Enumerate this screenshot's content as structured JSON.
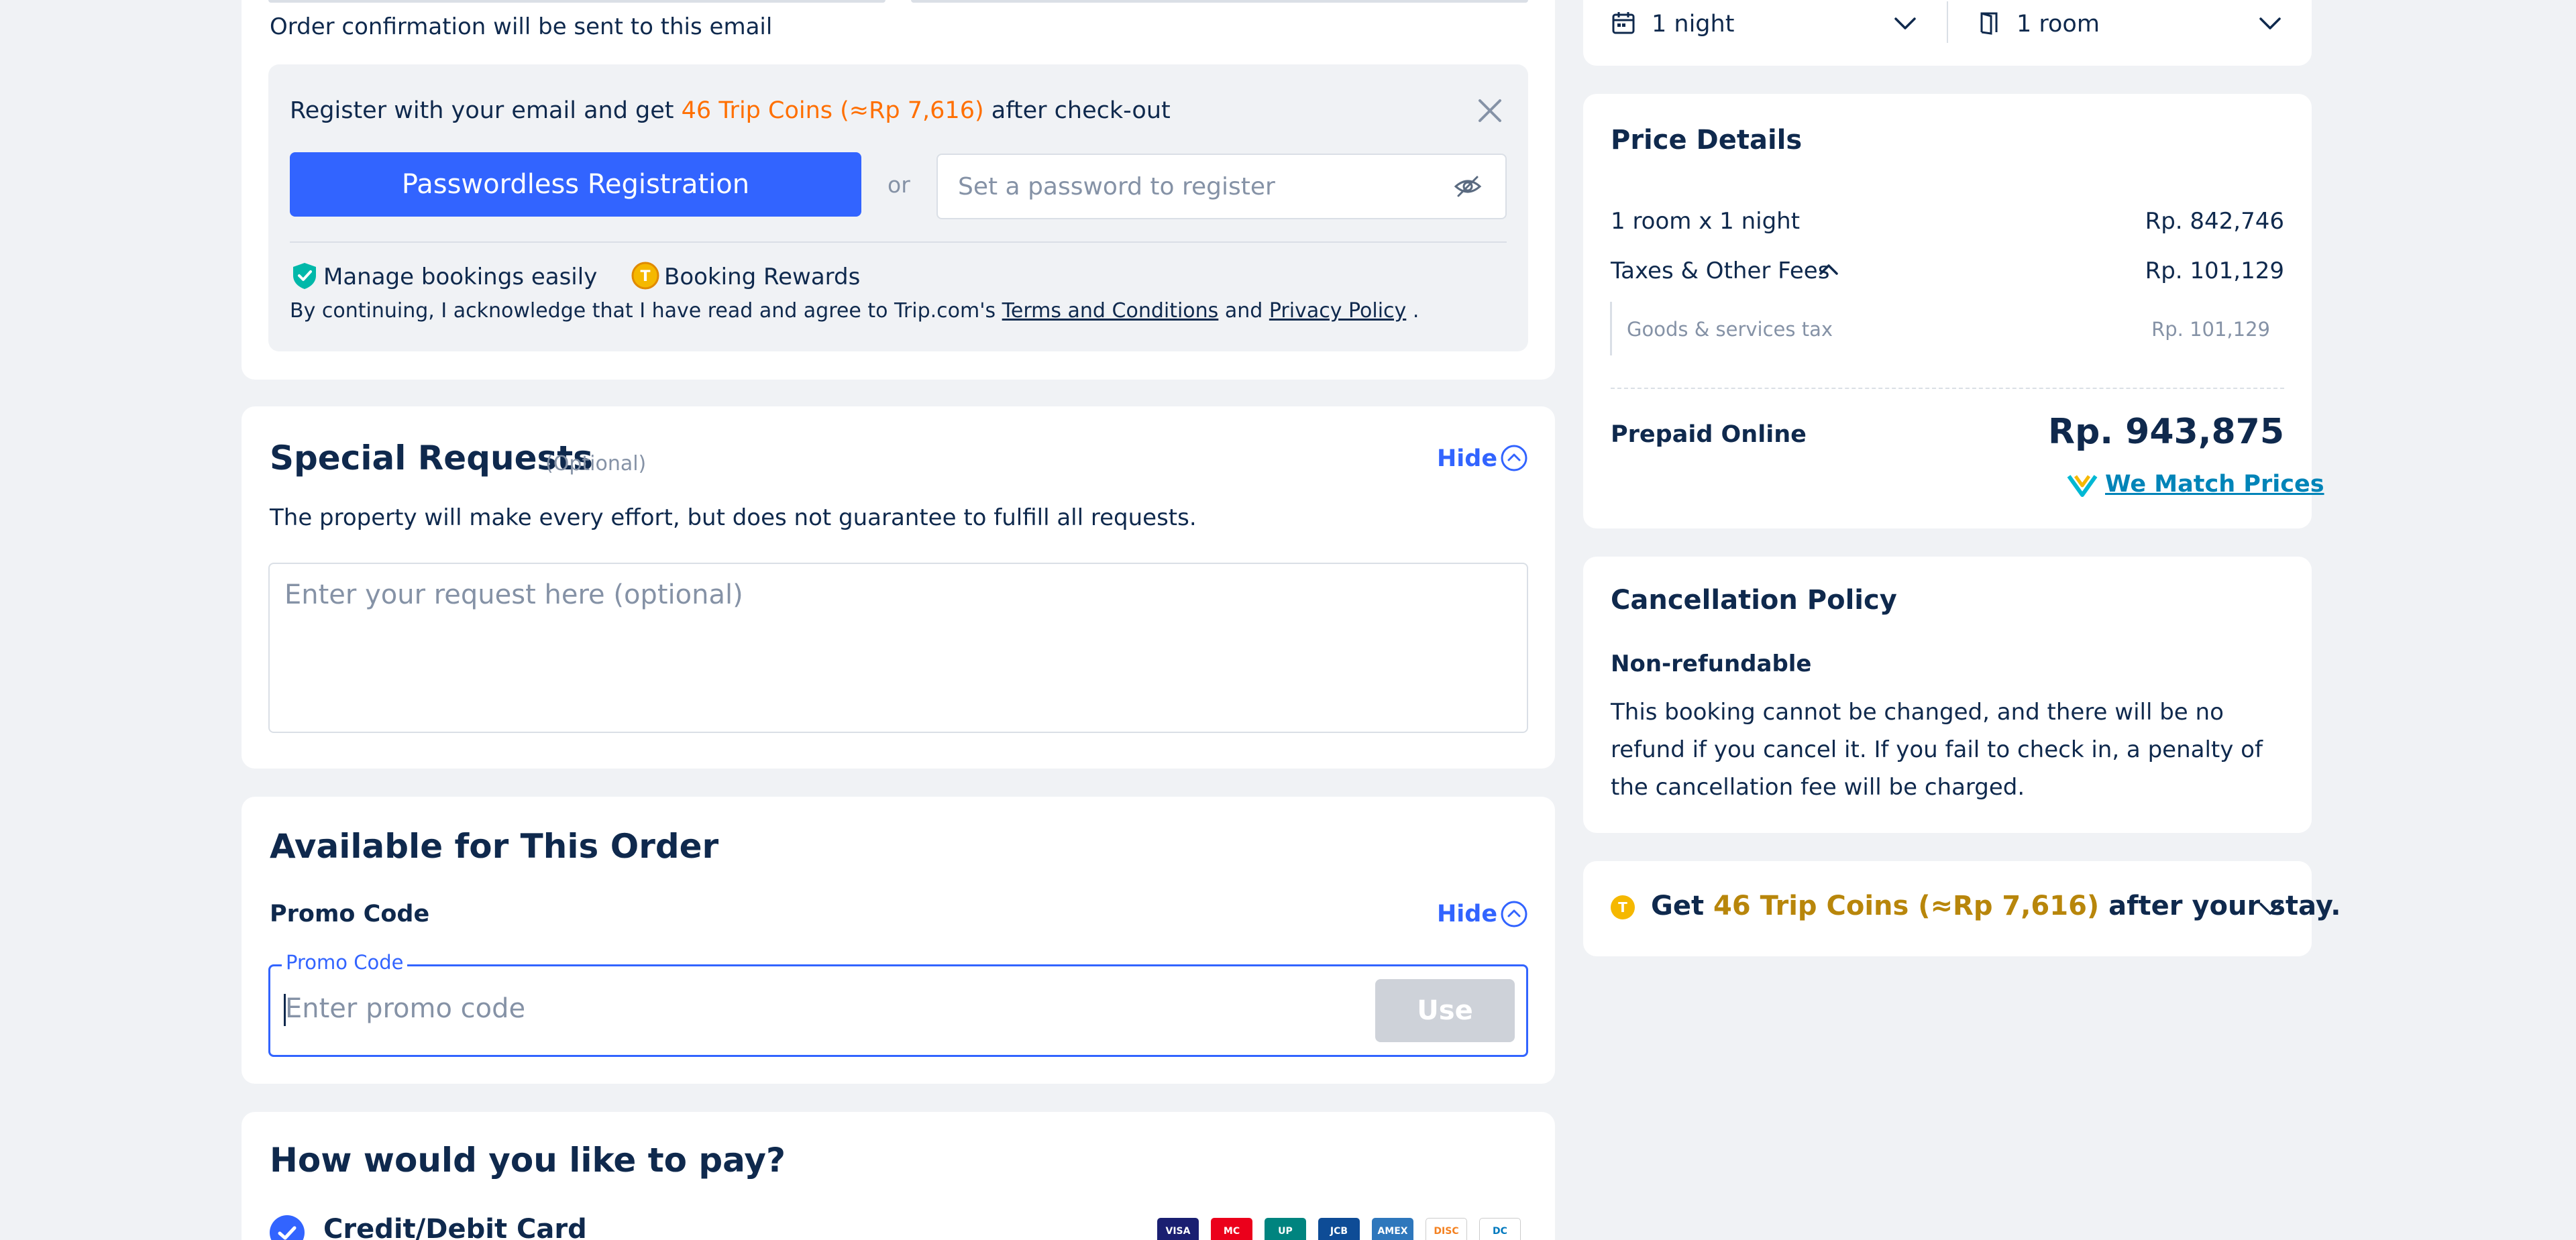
{
  "contact": {
    "email_note": "Order confirmation will be sent to this email"
  },
  "registration": {
    "title_before": "Register with your email and get ",
    "title_coins": "46 Trip Coins (≈Rp 7,616)",
    "title_after": " after check-out",
    "passwordless_button": "Passwordless Registration",
    "or": "or",
    "password_placeholder": "Set a password to register",
    "perk_manage": "Manage bookings easily",
    "perk_rewards": "Booking Rewards",
    "consent_before": "By continuing, I acknowledge that I have read and agree to Trip.com's ",
    "terms_link": "Terms and Conditions",
    "consent_and": " and ",
    "privacy_link": "Privacy Policy",
    "consent_after": " ."
  },
  "special_requests": {
    "title": "Special Requests",
    "optional": "(Optional)",
    "hide": "Hide",
    "note": "The property will make every effort, but does not guarantee to fulfill all requests.",
    "placeholder": "Enter your request here (optional)"
  },
  "available_order": {
    "title": "Available for This Order",
    "promo_label": "Promo Code",
    "hide": "Hide",
    "promo_float_label": "Promo Code",
    "promo_placeholder": "Enter promo code",
    "use_button": "Use"
  },
  "payment": {
    "title": "How would you like to pay?",
    "credit_card_label": "Credit/Debit Card",
    "card_brands": [
      "VISA",
      "MC",
      "UP",
      "JCB",
      "AMEX",
      "DISC",
      "DC"
    ]
  },
  "stay_selector": {
    "nights": "1 night",
    "rooms": "1 room"
  },
  "price_details": {
    "title": "Price Details",
    "room_line_label": "1 room x 1 night",
    "room_line_value": "Rp. 842,746",
    "taxes_label": "Taxes & Other Fees",
    "taxes_value": "Rp. 101,129",
    "gst_label": "Goods & services tax",
    "gst_value": "Rp. 101,129",
    "prepaid_label": "Prepaid Online",
    "prepaid_value": "Rp. 943,875",
    "match_prices": "We Match Prices"
  },
  "cancellation": {
    "title": "Cancellation Policy",
    "subtitle": "Non-refundable",
    "body": "This booking cannot be changed, and there will be no refund if you cancel it. If you fail to check in, a penalty of the cancellation fee will be charged."
  },
  "trip_coins": {
    "before": "Get ",
    "coins": "46 Trip Coins (≈Rp 7,616)",
    "after": " after your stay."
  },
  "colors": {
    "primary": "#3264ff",
    "text": "#0f294d",
    "coin_orange": "#ff6f00",
    "background": "#f0f2f5"
  }
}
